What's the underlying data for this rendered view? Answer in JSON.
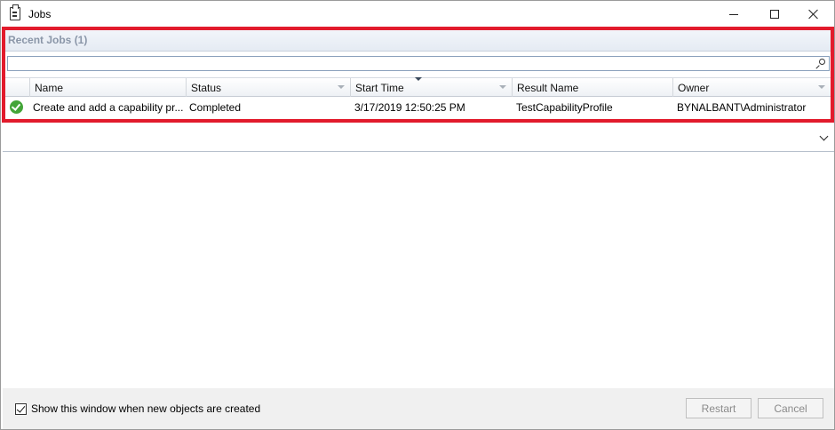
{
  "window": {
    "title": "Jobs",
    "icon": "clipboard-icon"
  },
  "recent_jobs": {
    "title": "Recent Jobs (1)",
    "search": {
      "value": "",
      "placeholder": ""
    },
    "columns": [
      {
        "key": "status_icon",
        "label": ""
      },
      {
        "key": "name",
        "label": "Name"
      },
      {
        "key": "status",
        "label": "Status"
      },
      {
        "key": "start_time",
        "label": "Start Time",
        "sorted": "descending"
      },
      {
        "key": "result_name",
        "label": "Result Name"
      },
      {
        "key": "owner",
        "label": "Owner"
      }
    ],
    "rows": [
      {
        "status_icon": "success-check-icon",
        "name": "Create and add a capability pr...",
        "status": "Completed",
        "start_time": "3/17/2019 12:50:25 PM",
        "result_name": "TestCapabilityProfile",
        "owner": "BYNALBANT\\Administrator"
      }
    ]
  },
  "footer": {
    "show_window_label": "Show this window when new objects are created",
    "show_window_checked": true,
    "restart_label": "Restart",
    "cancel_label": "Cancel"
  },
  "colors": {
    "highlight_border": "#e21b2c",
    "success_green": "#43a538",
    "panel_title": "#8a96a8"
  }
}
